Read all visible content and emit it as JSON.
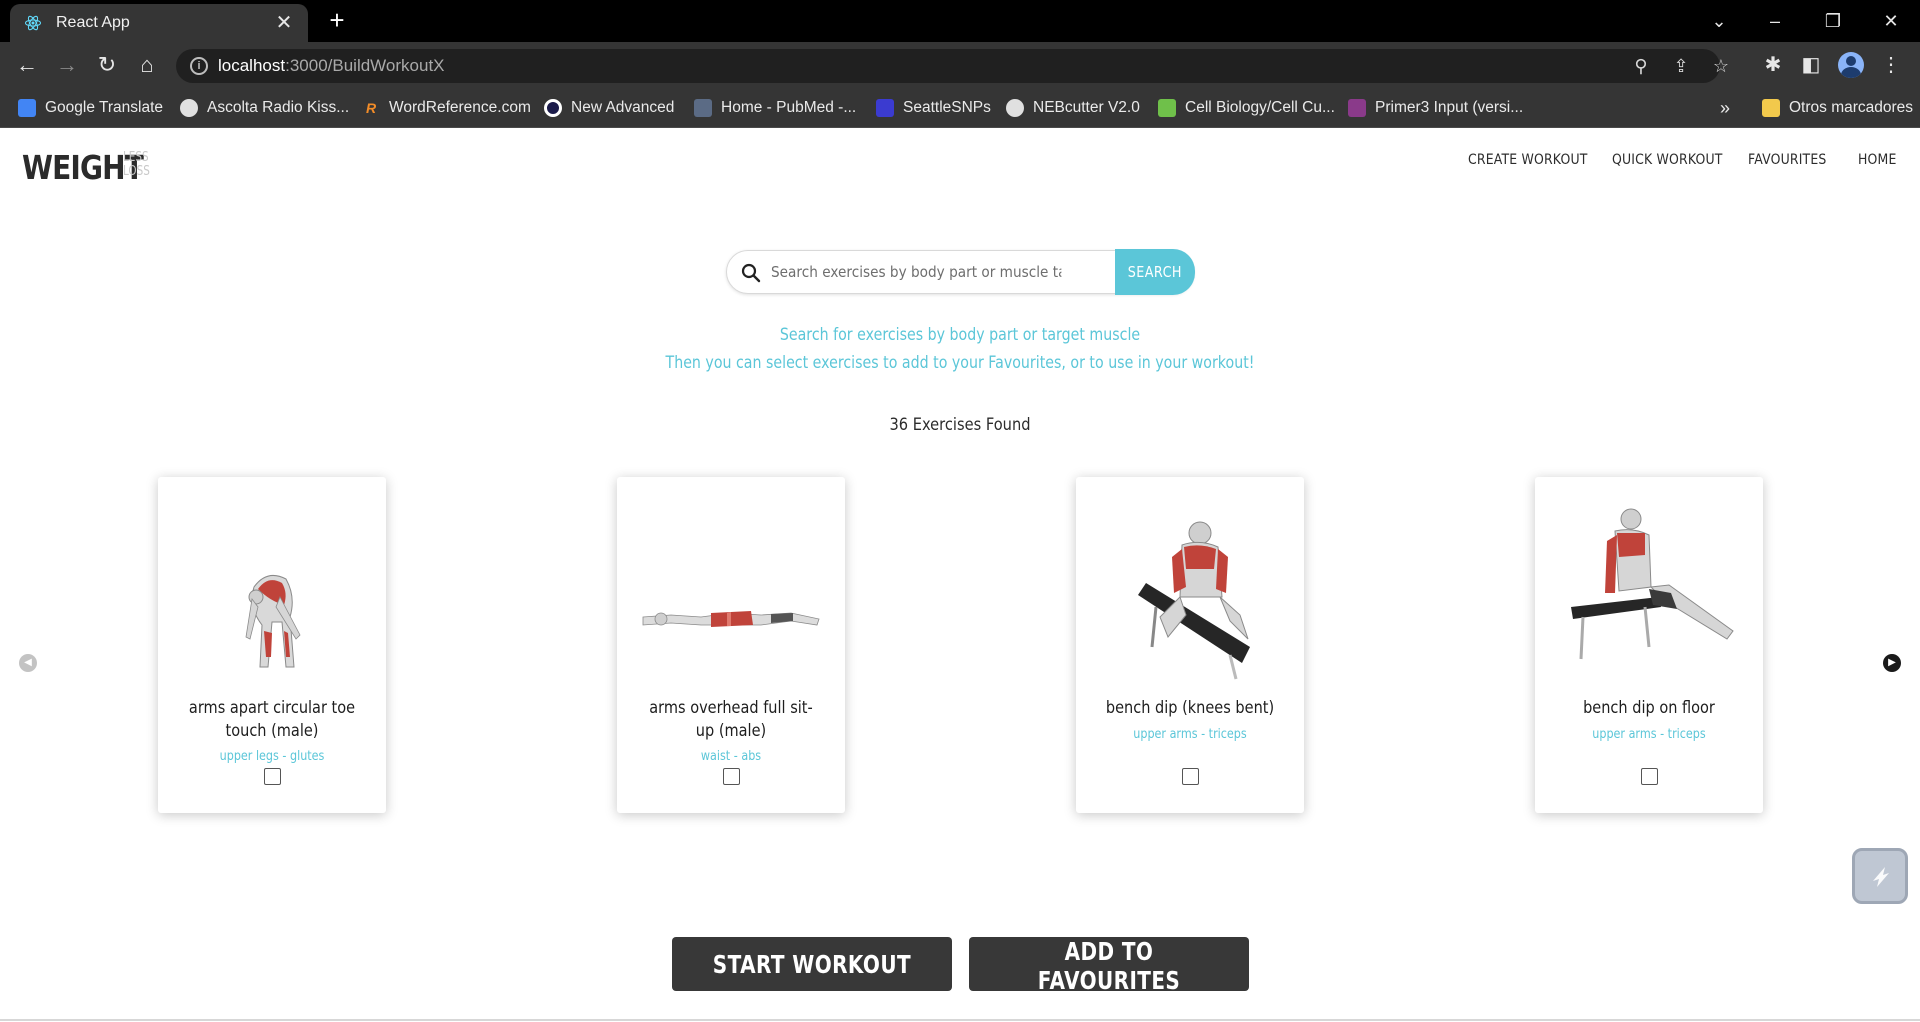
{
  "browser": {
    "tab_title": "React App",
    "url_host": "localhost",
    "url_path": ":3000/BuildWorkoutX",
    "bookmarks": [
      {
        "label": "Google Translate",
        "icon": "google-translate-icon",
        "color": "#4285f4"
      },
      {
        "label": "Ascolta Radio Kiss...",
        "icon": "globe-icon",
        "color": "#e0e0e0"
      },
      {
        "label": "WordReference.com",
        "icon": "wordreference-icon",
        "color": "#f28c28"
      },
      {
        "label": "New Advanced",
        "icon": "circle-logo-icon",
        "color": "#1b1b4a"
      },
      {
        "label": "Home - PubMed -...",
        "icon": "pubmed-icon",
        "color": "#5b6b85"
      },
      {
        "label": "SeattleSNPs",
        "icon": "seattlesnps-icon",
        "color": "#3b3bd0"
      },
      {
        "label": "NEBcutter V2.0",
        "icon": "globe-icon",
        "color": "#e0e0e0"
      },
      {
        "label": "Cell Biology/Cell Cu...",
        "icon": "cell-biology-icon",
        "color": "#6fc04a"
      },
      {
        "label": "Primer3 Input (versi...",
        "icon": "primer3-icon",
        "color": "#8a3a8a"
      }
    ],
    "overflow_label": "»",
    "other_bookmarks": "Otros marcadores"
  },
  "site": {
    "logo_main": "WEIGHT",
    "logo_sub_1": "LESS",
    "logo_sub_2": "LOSS",
    "nav": [
      "CREATE WORKOUT",
      "QUICK WORKOUT",
      "FAVOURITES",
      "HOME"
    ]
  },
  "search": {
    "placeholder": "Search exercises by body part or muscle target",
    "button_label": "SEARCH"
  },
  "hint_line_1": "Search for exercises by body part or target muscle",
  "hint_line_2": "Then you can select exercises to add to your Favourites, or to use in your workout!",
  "results_label": "36 Exercises Found",
  "exercises": [
    {
      "name_line_1": "arms apart circular toe",
      "name_line_2": "touch (male)",
      "tag": "upper legs - glutes",
      "checked": false
    },
    {
      "name_line_1": "arms overhead full sit-",
      "name_line_2": "up (male)",
      "tag": "waist - abs",
      "checked": false
    },
    {
      "name_line_1": "bench dip (knees bent)",
      "name_line_2": "",
      "tag": "upper arms - triceps",
      "checked": false
    },
    {
      "name_line_1": "bench dip on floor",
      "name_line_2": "",
      "tag": "upper arms - triceps",
      "checked": false
    }
  ],
  "actions": {
    "start_workout": "START WORKOUT",
    "add_to_favourites": "ADD TO FAVOURITES"
  },
  "colors": {
    "accent": "#5bc6d8",
    "dark_button": "#383838",
    "chrome_dark": "#353535"
  }
}
